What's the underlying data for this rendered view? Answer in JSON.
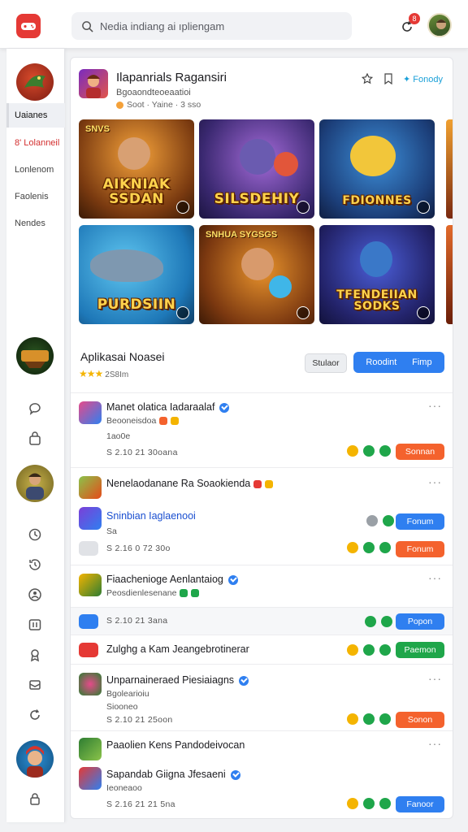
{
  "topbar": {
    "search_placeholder": "Nedia indiang ai ıpliengam",
    "notification_count": "8"
  },
  "sidebar": {
    "nav": [
      {
        "label": "Uaianes"
      },
      {
        "label": "8' Lolanneil"
      },
      {
        "label": "Lonlenom"
      },
      {
        "label": "Faolenis"
      },
      {
        "label": "Nendes"
      }
    ],
    "icons": [
      "chat-icon",
      "bag-icon",
      "clock-icon",
      "history-icon",
      "user-group-icon",
      "grid-icon",
      "award-icon",
      "gift-icon",
      "refresh-icon",
      "lock-icon"
    ]
  },
  "featured": {
    "title": "Ilapanrials Ragansiri",
    "subtitle": "Bgoaondteoeaatioi",
    "meta": "Soot · Yaine · 3 sso",
    "action_label": "Fonody",
    "tiles": [
      {
        "label": "AIKNIAK SSDAN",
        "tag": "SNVS"
      },
      {
        "label": "SILSDEHIY",
        "tag": ""
      },
      {
        "label": "FDIONNES",
        "tag": ""
      },
      {
        "label": "PURDSIIN",
        "tag": ""
      },
      {
        "label": "",
        "tag": "SNHUA SYGSGS"
      },
      {
        "label": "TFENDEIIAN SODKS",
        "tag": ""
      }
    ]
  },
  "section": {
    "title": "Aplikasai Noasei",
    "rating_text": "2S8Im",
    "secondary_button": "Stulaor",
    "primary_button_left": "Roodint",
    "primary_button_right": "Fimp"
  },
  "apps": [
    {
      "title": "Manet olatica Iadaraalaf",
      "dev": "Beooneisdoa",
      "meta": "1ao0e",
      "stats": "S 2.10 21 30oana",
      "action": "Sonnan"
    },
    {
      "title": "Nenelaodanane Ra Soaokienda",
      "dev": "",
      "meta": "",
      "stats": "",
      "action": ""
    },
    {
      "title": "Sninbian Iaglaenooi",
      "dev": "Sa",
      "meta": "",
      "stats": "S 2.16 0 72 30o",
      "action": "Fonum"
    },
    {
      "title": "Fiaachenioge Aenlantaiog",
      "dev": "Peosdienlesenane",
      "meta": "",
      "stats": "",
      "action": ""
    },
    {
      "title": "",
      "dev": "",
      "meta": "",
      "stats": "S 2.10 21 3ana",
      "action": "Popon"
    },
    {
      "title": "Zulghg a Kam Jeangebrotinerar",
      "dev": "",
      "meta": "",
      "stats": "",
      "action": "Paemon"
    },
    {
      "title": "Unparnaineraed Piesiaiagns",
      "dev": "Bgolearioiu",
      "meta": "Siooneo",
      "stats": "S 2.10 21 25oon",
      "action": "Sonon"
    },
    {
      "title": "Paaolien Kens Pandodeivocan",
      "dev": "",
      "meta": "",
      "stats": "",
      "action": ""
    },
    {
      "title": "Sapandab Giigna Jfesaeni",
      "dev": "Ieoneaoo",
      "meta": "",
      "stats": "S 2.16 21 21 5na",
      "action": "Fanoor"
    }
  ],
  "colors": {
    "accent": "#2f7ff0",
    "brand_red": "#e53935",
    "orange": "#f4622d",
    "green": "#1fa64a",
    "yellow": "#f4b400"
  }
}
